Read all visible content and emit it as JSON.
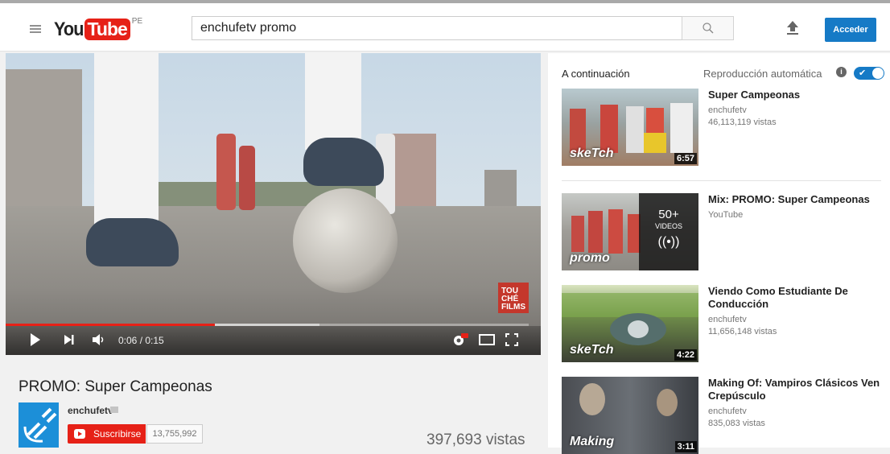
{
  "header": {
    "logo_you": "You",
    "logo_tube": "Tube",
    "logo_country": "PE",
    "search_value": "enchufetv promo",
    "signin_label": "Acceder"
  },
  "player": {
    "time_current": "0:06",
    "time_total": "0:15",
    "time_display": "0:06 / 0:15",
    "progress_fraction": 0.4,
    "loaded_fraction": 0.6,
    "watermark": "TOU CHÉ FILMS"
  },
  "video": {
    "title": "PROMO: Super Campeonas",
    "channel": "enchufetv",
    "subscribe_label": "Suscribirse",
    "subscriber_count": "13,755,992",
    "views": "397,693 vistas"
  },
  "sidebar": {
    "next_label": "A continuación",
    "autoplay_label": "Reproducción automática",
    "autoplay_on": true,
    "items": [
      {
        "title": "Super Campeonas",
        "channel": "enchufetv",
        "views": "46,113,119 vistas",
        "duration": "6:57",
        "tag": "skeTch"
      },
      {
        "title": "Mix: PROMO: Super Campeonas",
        "channel": "YouTube",
        "views": "",
        "mix_count": "50+",
        "mix_label": "VIDEOS",
        "tag": "promo"
      },
      {
        "title": "Viendo Como Estudiante De Conducción",
        "channel": "enchufetv",
        "views": "11,656,148 vistas",
        "duration": "4:22",
        "tag": "skeTch"
      },
      {
        "title": "Making Of: Vampiros Clásicos Ven Crepúsculo",
        "channel": "enchufetv",
        "views": "835,083 vistas",
        "duration": "3:11",
        "tag": "Making"
      }
    ]
  },
  "colors": {
    "brand_red": "#e62117",
    "accent_blue": "#167ac6"
  }
}
